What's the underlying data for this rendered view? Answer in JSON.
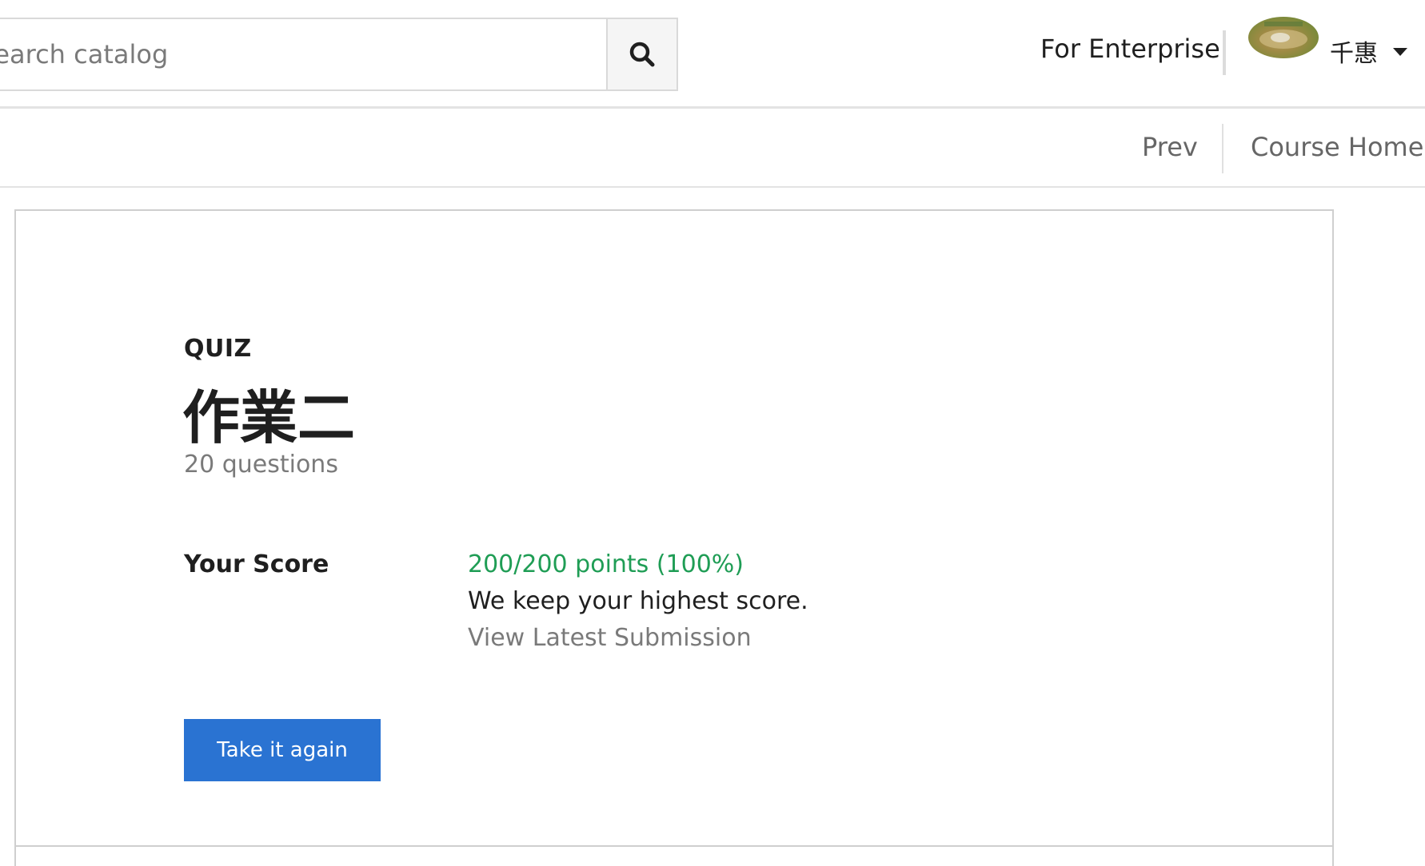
{
  "header": {
    "search_placeholder": "Search catalog",
    "search_value": "",
    "enterprise_label": "For Enterprise",
    "user_name": "千惠"
  },
  "subnav": {
    "prev_label": "Prev",
    "course_home_label": "Course Home"
  },
  "quiz": {
    "type_label": "QUIZ",
    "title": "作業二",
    "question_count": "20 questions",
    "score_label": "Your Score",
    "score_value": "200/200 points (100%)",
    "score_note": "We keep your highest score.",
    "view_submission_label": "View Latest Submission",
    "retake_label": "Take it again"
  },
  "colors": {
    "accent_button": "#2a73d2",
    "score_green": "#1f9d55"
  },
  "icons": {
    "search": "search-icon",
    "caret": "caret-down-icon"
  }
}
